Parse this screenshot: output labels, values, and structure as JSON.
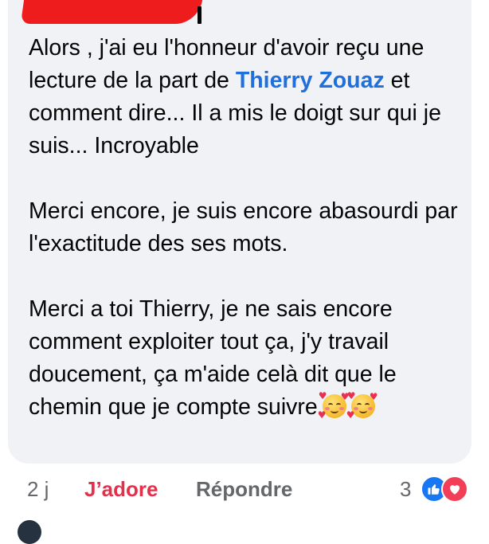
{
  "comment": {
    "author_redacted": true,
    "paragraphs": [
      {
        "before": "Alors , j'ai eu l'honneur d'avoir reçu une lecture de la part de ",
        "mention": "Thierry Zouaz",
        "after": " et comment dire... Il a mis le doigt sur qui je suis... Incroyable"
      },
      {
        "text": "Merci encore, je suis encore abasourdi par l'exactitude des ses mots."
      },
      {
        "text": "Merci a toi Thierry, je ne sais encore comment exploiter tout ça, j'y travail doucement, ça m'aide celà dit que le chemin que je compte suivre"
      }
    ],
    "emoji": "smiling-face-with-hearts"
  },
  "actions": {
    "time": "2 j",
    "reaction_label": "J’adore",
    "reply_label": "Répondre",
    "reaction_count": "3"
  },
  "colors": {
    "bubble_bg": "#f0f2f5",
    "mention": "#1f6fde",
    "love_red": "#e4304a",
    "like_blue": "#1877f2",
    "muted": "#65676b"
  },
  "icons": [
    "like-reaction-icon",
    "love-reaction-icon",
    "smiling-face-with-hearts-icon"
  ]
}
